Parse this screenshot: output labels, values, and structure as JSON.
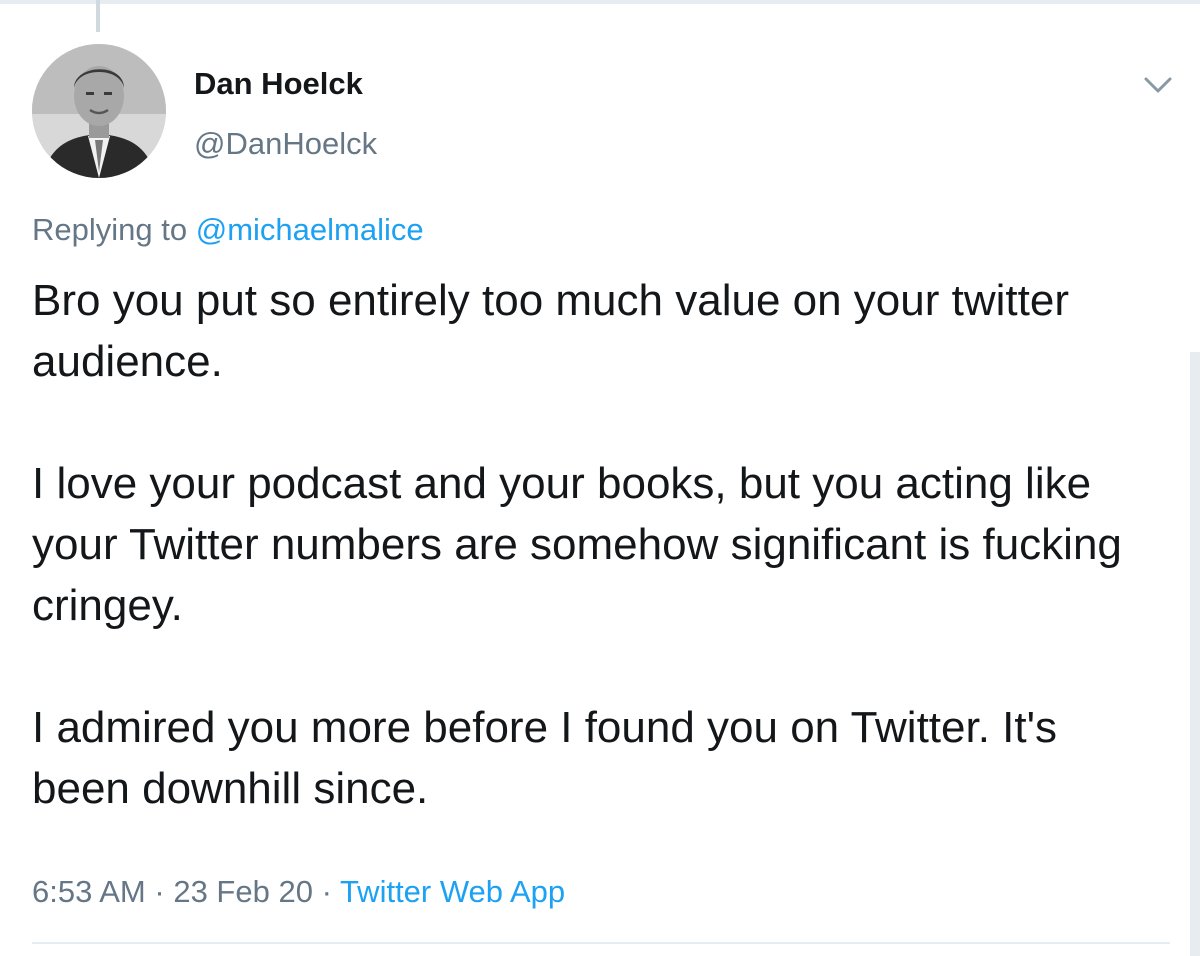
{
  "author": {
    "name": "Dan Hoelck",
    "handle": "@DanHoelck"
  },
  "reply": {
    "prefix": "Replying to",
    "mention": "@michaelmalice"
  },
  "tweet": {
    "paragraphs": [
      "Bro you put so entirely too much value on your twitter audience.",
      "I love your podcast and your books, but you acting like your Twitter numbers are somehow significant is fucking cringey.",
      "I admired you more before I found you on Twitter. It's been downhill since."
    ]
  },
  "meta": {
    "time": "6:53 AM",
    "separator1": "·",
    "date": "23 Feb 20",
    "separator2": "·",
    "source": "Twitter Web App"
  },
  "icons": {
    "caret": "chevron-down-icon",
    "avatar": "profile-photo"
  },
  "colors": {
    "link": "#1da1f2",
    "secondary": "#657786",
    "text": "#14171a",
    "divider": "#e6ecf0"
  }
}
